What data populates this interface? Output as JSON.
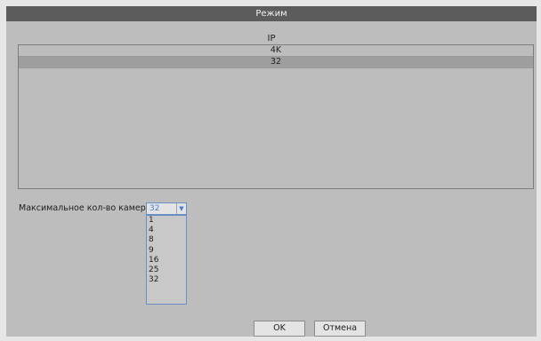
{
  "dialog": {
    "title": "Режим",
    "header": "IP",
    "list": {
      "items": [
        {
          "label": "4K",
          "selected": false
        },
        {
          "label": "32",
          "selected": true
        }
      ]
    },
    "max_cameras": {
      "label": "Максимальное кол-во камер:",
      "value": "32",
      "options": [
        "1",
        "4",
        "8",
        "9",
        "16",
        "25",
        "32"
      ]
    },
    "buttons": {
      "ok": "OK",
      "cancel": "Отмена"
    }
  },
  "colors": {
    "titlebar": "#5c5c5c",
    "dialog_bg": "#bdbdbd",
    "selected_row": "#9e9e9e",
    "select_accent": "#4a7cc8"
  }
}
